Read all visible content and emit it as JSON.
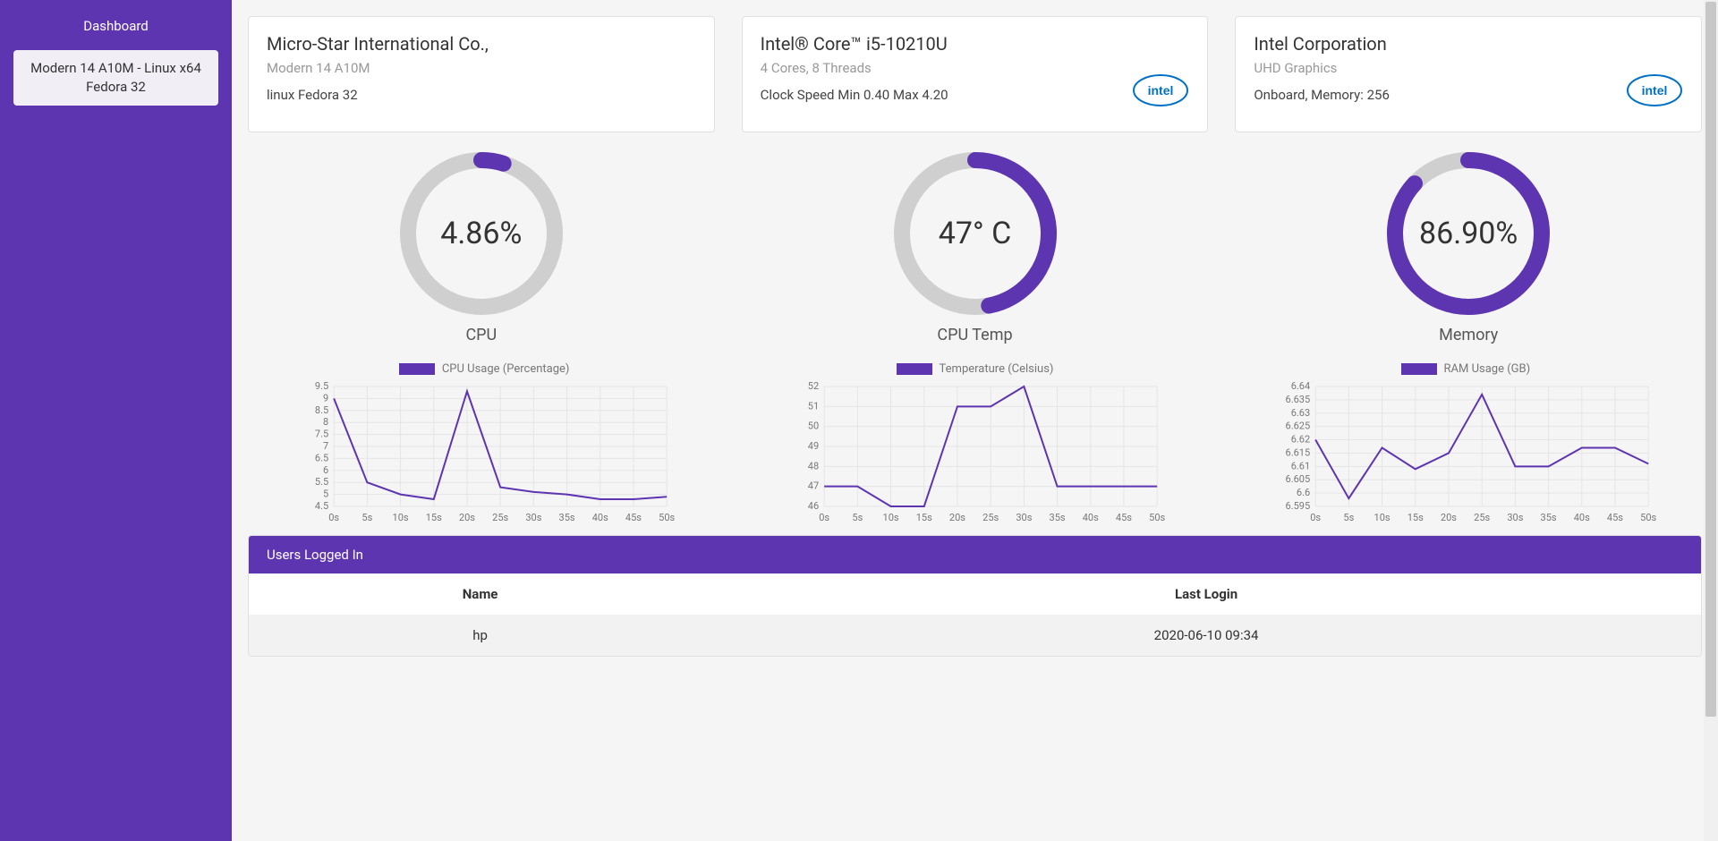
{
  "sidebar": {
    "title": "Dashboard",
    "item": "Modern 14 A10M - Linux x64 Fedora 32"
  },
  "cards": {
    "system": {
      "title": "Micro-Star International Co.,",
      "sub": "Modern 14 A10M",
      "line": "linux Fedora 32"
    },
    "cpu": {
      "title": "Intel® Core™ i5-10210U",
      "sub": "4 Cores, 8 Threads",
      "line": "Clock Speed Min 0.40 Max 4.20"
    },
    "gpu": {
      "title": "Intel Corporation",
      "sub": "UHD Graphics",
      "line": "Onboard, Memory: 256"
    }
  },
  "gauges": {
    "cpu": {
      "value": 4.86,
      "display": "4.86%",
      "label": "CPU"
    },
    "temp": {
      "value": 47,
      "max": 100,
      "display": "47° C",
      "label": "CPU Temp"
    },
    "mem": {
      "value": 86.9,
      "display": "86.90%",
      "label": "Memory"
    }
  },
  "chart_data": [
    {
      "type": "line",
      "title": "CPU Usage (Percentage)",
      "xlabel": "",
      "ylabel": "",
      "categories": [
        "0s",
        "5s",
        "10s",
        "15s",
        "20s",
        "25s",
        "30s",
        "35s",
        "40s",
        "45s",
        "50s"
      ],
      "values": [
        9.0,
        5.5,
        5.0,
        4.8,
        9.3,
        5.3,
        5.1,
        5.0,
        4.8,
        4.8,
        4.9
      ],
      "yticks": [
        4.5,
        5.0,
        5.5,
        6.0,
        6.5,
        7.0,
        7.5,
        8.0,
        8.5,
        9.0,
        9.5
      ],
      "ylim": [
        4.5,
        9.5
      ]
    },
    {
      "type": "line",
      "title": "Temperature (Celsius)",
      "xlabel": "",
      "ylabel": "",
      "categories": [
        "0s",
        "5s",
        "10s",
        "15s",
        "20s",
        "25s",
        "30s",
        "35s",
        "40s",
        "45s",
        "50s"
      ],
      "values": [
        47,
        47,
        46,
        46,
        51,
        51,
        52,
        47,
        47,
        47,
        47
      ],
      "yticks": [
        46,
        47,
        48,
        49,
        50,
        51,
        52
      ],
      "ylim": [
        46,
        52
      ]
    },
    {
      "type": "line",
      "title": "RAM Usage (GB)",
      "xlabel": "",
      "ylabel": "",
      "categories": [
        "0s",
        "5s",
        "10s",
        "15s",
        "20s",
        "25s",
        "30s",
        "35s",
        "40s",
        "45s",
        "50s"
      ],
      "values": [
        6.62,
        6.598,
        6.617,
        6.609,
        6.615,
        6.637,
        6.61,
        6.61,
        6.617,
        6.617,
        6.611
      ],
      "yticks": [
        6.595,
        6.6,
        6.605,
        6.61,
        6.615,
        6.62,
        6.625,
        6.63,
        6.635,
        6.64
      ],
      "ylim": [
        6.595,
        6.64
      ]
    }
  ],
  "users": {
    "header": "Users Logged In",
    "columns": [
      "Name",
      "Last Login"
    ],
    "rows": [
      {
        "name": "hp",
        "last_login": "2020-06-10 09:34"
      }
    ]
  },
  "colors": {
    "accent": "#5e35b1",
    "track": "#cfcfcf"
  }
}
